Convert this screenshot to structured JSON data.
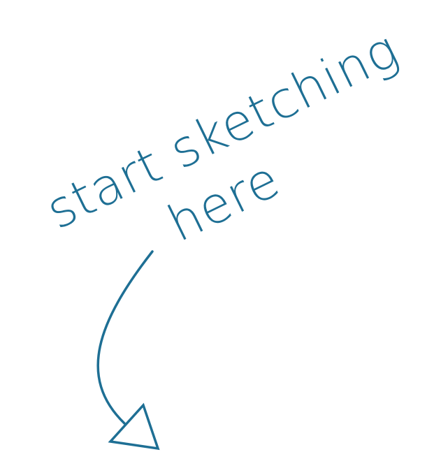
{
  "canvas": {
    "hint_line1": "start sketching",
    "hint_line2": "here",
    "accent_color": "#1e6f94",
    "background_color": "#ffffff"
  },
  "icons": {
    "arrow": "curved-arrow-down-icon"
  }
}
